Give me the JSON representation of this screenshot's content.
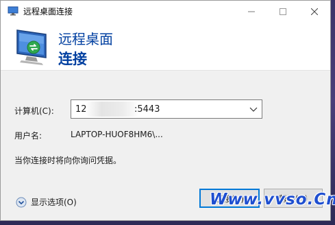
{
  "window": {
    "title": "远程桌面连接"
  },
  "header": {
    "line1": "远程桌面",
    "line2": "连接"
  },
  "form": {
    "computer_label": "计算机(C):",
    "computer_value_prefix": "12",
    "computer_value_suffix": ":5443",
    "username_label": "用户名:",
    "username_value": "LAPTOP-HUOF8HM6\\...",
    "prompt_text": "当你连接时将向你询问凭据。"
  },
  "footer": {
    "options_label": "显示选项(O)",
    "connect_label": "连接(N)",
    "help_label": "帮助(H)"
  },
  "watermark": "Www.vvso.Cn",
  "colors": {
    "header_text": "#003fa0",
    "focus_border": "#0078d7",
    "watermark": "#1f4fd0"
  }
}
